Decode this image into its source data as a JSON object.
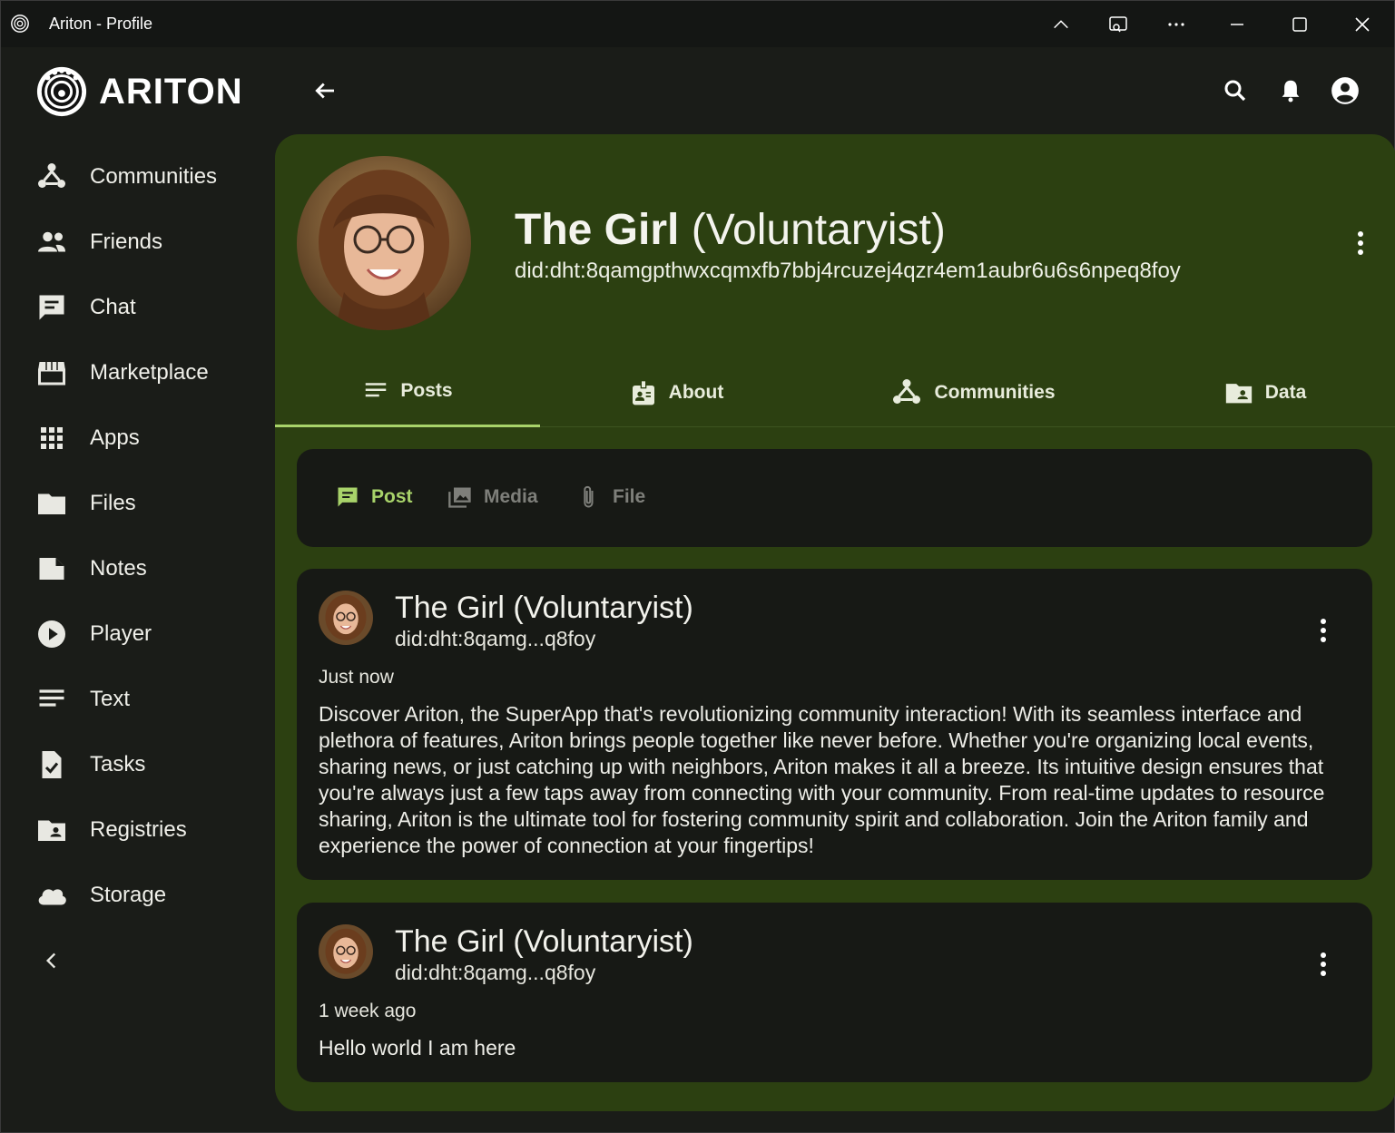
{
  "window": {
    "title": "Ariton - Profile"
  },
  "brand": {
    "name": "ARITON"
  },
  "sidebar": {
    "items": [
      {
        "label": "Communities",
        "icon": "communities-icon"
      },
      {
        "label": "Friends",
        "icon": "friends-icon"
      },
      {
        "label": "Chat",
        "icon": "chat-icon"
      },
      {
        "label": "Marketplace",
        "icon": "store-icon"
      },
      {
        "label": "Apps",
        "icon": "apps-grid-icon"
      },
      {
        "label": "Files",
        "icon": "folder-icon"
      },
      {
        "label": "Notes",
        "icon": "note-icon"
      },
      {
        "label": "Player",
        "icon": "play-icon"
      },
      {
        "label": "Text",
        "icon": "text-lines-icon"
      },
      {
        "label": "Tasks",
        "icon": "task-icon"
      },
      {
        "label": "Registries",
        "icon": "registry-folder-icon"
      },
      {
        "label": "Storage",
        "icon": "cloud-icon"
      }
    ]
  },
  "profile": {
    "name": "The Girl",
    "role": "(Voluntaryist)",
    "did": "did:dht:8qamgpthwxcqmxfb7bbj4rcuzej4qzr4em1aubr6u6s6npeq8foy"
  },
  "tabs": [
    {
      "label": "Posts",
      "icon": "lines-icon",
      "active": true
    },
    {
      "label": "About",
      "icon": "badge-icon",
      "active": false
    },
    {
      "label": "Communities",
      "icon": "communities-icon",
      "active": false
    },
    {
      "label": "Data",
      "icon": "folder-shared-icon",
      "active": false
    }
  ],
  "composer": {
    "post": "Post",
    "media": "Media",
    "file": "File"
  },
  "posts": [
    {
      "author": "The Girl (Voluntaryist)",
      "did": "did:dht:8qamg...q8foy",
      "time": "Just now",
      "body": "Discover Ariton, the SuperApp that's revolutionizing community interaction! With its seamless interface and plethora of features, Ariton brings people together like never before. Whether you're organizing local events, sharing news, or just catching up with neighbors, Ariton makes it all a breeze. Its intuitive design ensures that you're always just a few taps away from connecting with your community. From real-time updates to resource sharing, Ariton is the ultimate tool for fostering community spirit and collaboration. Join the Ariton family and experience the power of connection at your fingertips!"
    },
    {
      "author": "The Girl (Voluntaryist)",
      "did": "did:dht:8qamg...q8foy",
      "time": "1 week ago",
      "body": "Hello world I am here"
    }
  ],
  "colors": {
    "accent": "#a8d36a",
    "panel": "#2c4011",
    "card": "#171915",
    "background": "#1a1c18"
  }
}
